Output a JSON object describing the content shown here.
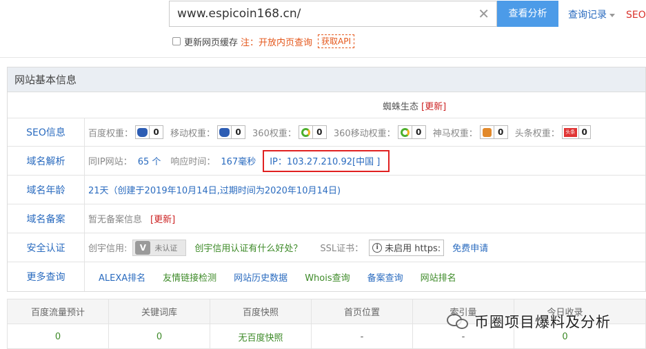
{
  "search": {
    "value": "www.espicoin168.cn/",
    "clear_icon": "close-icon",
    "analyze_label": "查看分析",
    "history_label": "查询记录",
    "seo_label": "SEO综"
  },
  "options": {
    "refresh_cache_label": "更新网页缓存",
    "note": "注：开放内页查询",
    "api_label": "获取API"
  },
  "panel": {
    "title": "网站基本信息",
    "spider": {
      "label": "蜘蛛生态",
      "update": "[更新]"
    },
    "seo": {
      "label": "SEO信息",
      "weights": [
        {
          "name": "百度权重：",
          "icon": "baidu-paw-icon",
          "value": "0"
        },
        {
          "name": "移动权重：",
          "icon": "baidu-paw-icon",
          "value": "0"
        },
        {
          "name": "360权重：",
          "icon": "360-icon",
          "value": "0"
        },
        {
          "name": "360移动权重：",
          "icon": "360-icon",
          "value": "0"
        },
        {
          "name": "神马权重：",
          "icon": "shenma-icon",
          "value": "0"
        },
        {
          "name": "头条权重：",
          "icon": "toutiao-icon",
          "value": "0",
          "icon_text": "头条"
        }
      ]
    },
    "dns": {
      "label": "域名解析",
      "same_ip_label": "同IP网站：",
      "same_ip_value": "65 个",
      "response_label": "响应时间：",
      "response_value": "167毫秒",
      "ip_value": "IP：103.27.210.92[中国 ]"
    },
    "age": {
      "label": "域名年龄",
      "value": "21天（创建于2019年10月14日,过期时间为2020年10月14日)"
    },
    "beian": {
      "label": "域名备案",
      "value": "暂无备案信息",
      "update": "[更新]"
    },
    "security": {
      "label": "安全认证",
      "credit_label": "创宇信用:",
      "cert_text": "未认证",
      "cert_letter": "V",
      "credit_link": "创宇信用认证有什么好处？",
      "ssl_label": "SSL证书：",
      "ssl_status": "未启用 https:",
      "ssl_apply": "免费申请"
    },
    "more": {
      "label": "更多查询",
      "links": [
        "ALEXA排名",
        "友情链接检测",
        "网站历史数据",
        "Whois查询",
        "备案查询",
        "网站排名"
      ]
    }
  },
  "stats": {
    "headers": [
      "百度流量预计",
      "关键词库",
      "百度快照",
      "首页位置",
      "索引量",
      "今日收录"
    ],
    "values": [
      "0",
      "0",
      "无百度快照",
      "-",
      "-",
      "0"
    ]
  },
  "watermark": {
    "text": "币圈项目爆料及分析"
  }
}
